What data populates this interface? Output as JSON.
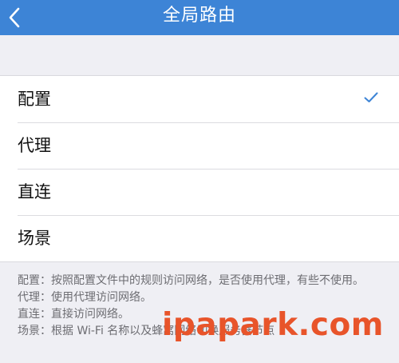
{
  "navbar": {
    "title": "全局路由",
    "back_icon": "chevron-left-icon",
    "background": "#3d84d6"
  },
  "options": [
    {
      "label": "配置",
      "selected": true
    },
    {
      "label": "代理",
      "selected": false
    },
    {
      "label": "直连",
      "selected": false
    },
    {
      "label": "场景",
      "selected": false
    }
  ],
  "check_color": "#3d84d6",
  "description": [
    "配置：按照配置文件中的规则访问网络，是否使用代理，有些不使用。",
    "代理：使用代理访问网络。",
    "直连：直接访问网络。",
    "场景：根据 Wi-Fi 名称以及蜂窝网络切换服务器节点"
  ],
  "watermark": "ipapark.com"
}
